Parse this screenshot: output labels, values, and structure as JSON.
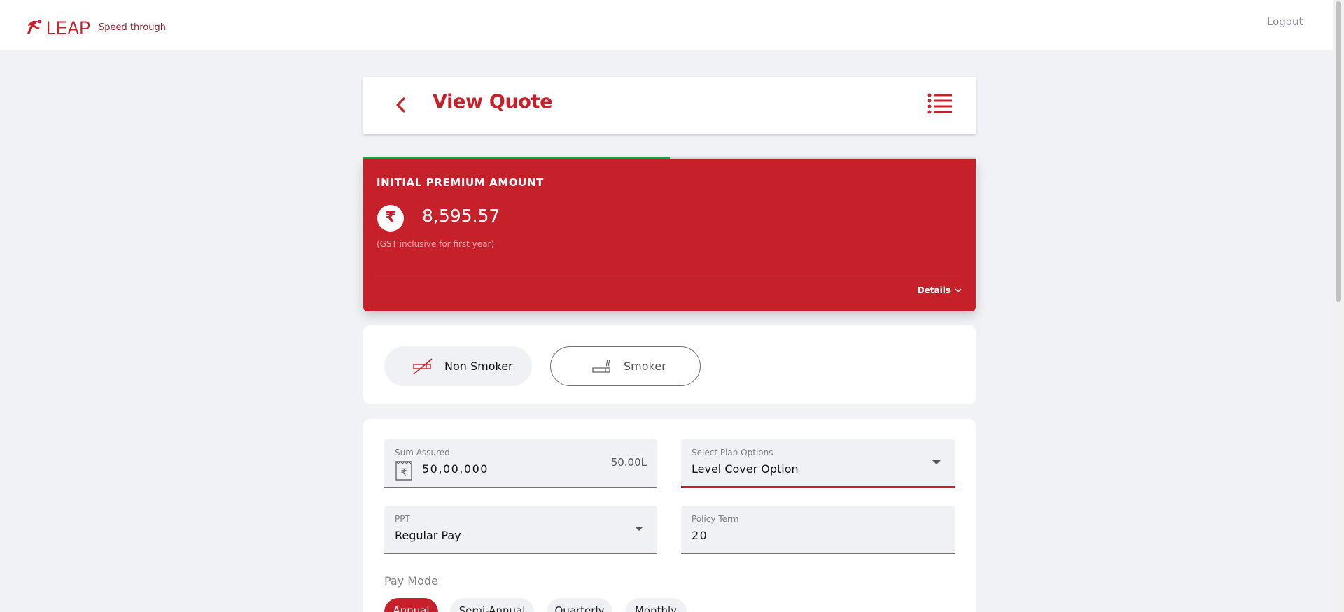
{
  "brand": {
    "name": "LEAP",
    "tagline": "Speed through",
    "accent": "#c6202a"
  },
  "topbar": {
    "logout_label": "Logout"
  },
  "header": {
    "title": "View Quote"
  },
  "progress": {
    "fraction": 0.5,
    "fill_color": "#2e9b4a"
  },
  "premium": {
    "label": "INITIAL PREMIUM AMOUNT",
    "currency_symbol": "₹",
    "amount": "8,595.57",
    "note": "(GST inclusive for first year)",
    "details_label": "Details"
  },
  "smoker": {
    "non_smoker_label": "Non Smoker",
    "smoker_label": "Smoker",
    "selected": "Non Smoker"
  },
  "form": {
    "sum_assured": {
      "label": "Sum Assured",
      "value": "50,00,000",
      "short": "50.00L"
    },
    "plan_options": {
      "label": "Select Plan Options",
      "value": "Level Cover Option"
    },
    "ppt": {
      "label": "PPT",
      "value": "Regular Pay"
    },
    "policy_term": {
      "label": "Policy Term",
      "value": "20"
    },
    "pay_mode": {
      "label": "Pay Mode",
      "options": [
        "Annual",
        "Semi-Annual",
        "Quarterly",
        "Monthly"
      ],
      "selected": "Annual"
    }
  }
}
